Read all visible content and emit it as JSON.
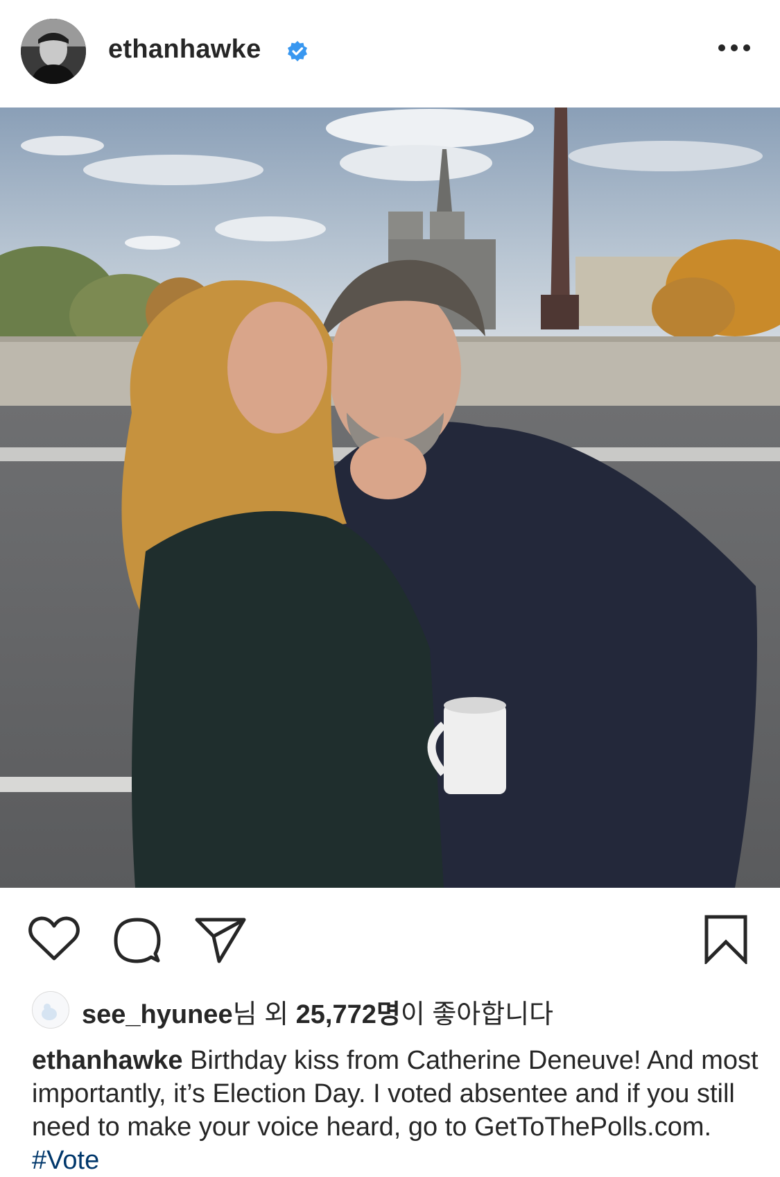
{
  "post": {
    "username": "ethanhawke",
    "verified": true,
    "likes": {
      "liker": "see_hyunee",
      "middle": "님 외 ",
      "count": "25,772명",
      "suffix": "이 좋아합니다"
    },
    "caption": {
      "username": "ethanhawke",
      "text": " Birthday kiss from Catherine Deneuve! And most importantly, it’s Election Day. I voted absentee and if you still need to make your voice heard, go to GetToThePolls.com. ",
      "hashtag": "#Vote"
    }
  },
  "icons": {
    "more": "more-options-icon",
    "like": "heart-icon",
    "comment": "comment-bubble-icon",
    "share": "paper-plane-icon",
    "save": "bookmark-icon",
    "verified": "verified-badge-icon"
  },
  "colors": {
    "text": "#262626",
    "verified_blue": "#3897f0",
    "hashtag": "#00376b",
    "background": "#ffffff"
  }
}
